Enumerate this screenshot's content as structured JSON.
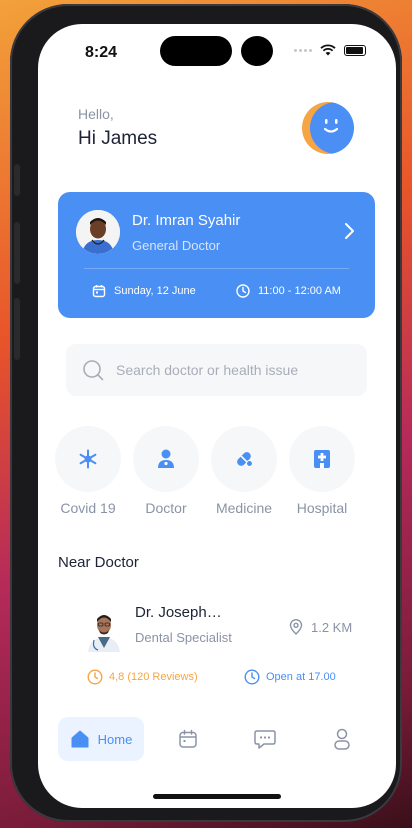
{
  "status_bar": {
    "time": "8:24"
  },
  "header": {
    "greeting": "Hello,",
    "name": "Hi James"
  },
  "appointment": {
    "doctor_name": "Dr. Imran Syahir",
    "doctor_role": "General Doctor",
    "date": "Sunday, 12 June",
    "time": "11:00 - 12:00 AM"
  },
  "search": {
    "placeholder": "Search doctor or health issue"
  },
  "categories": [
    {
      "label": "Covid 19",
      "icon": "virus-icon"
    },
    {
      "label": "Doctor",
      "icon": "doctor-icon"
    },
    {
      "label": "Medicine",
      "icon": "pill-icon"
    },
    {
      "label": "Hospital",
      "icon": "hospital-icon"
    }
  ],
  "near": {
    "section_title": "Near Doctor",
    "doctor_name": "Dr. Joseph…",
    "doctor_role": "Dental Specialist",
    "distance": "1.2 KM",
    "rating": "4,8 (120 Reviews)",
    "open": "Open at 17.00"
  },
  "tabbar": {
    "home_label": "Home"
  },
  "colors": {
    "accent": "#4a8ff3",
    "rating": "#f5a544",
    "muted": "#8a93a6"
  }
}
